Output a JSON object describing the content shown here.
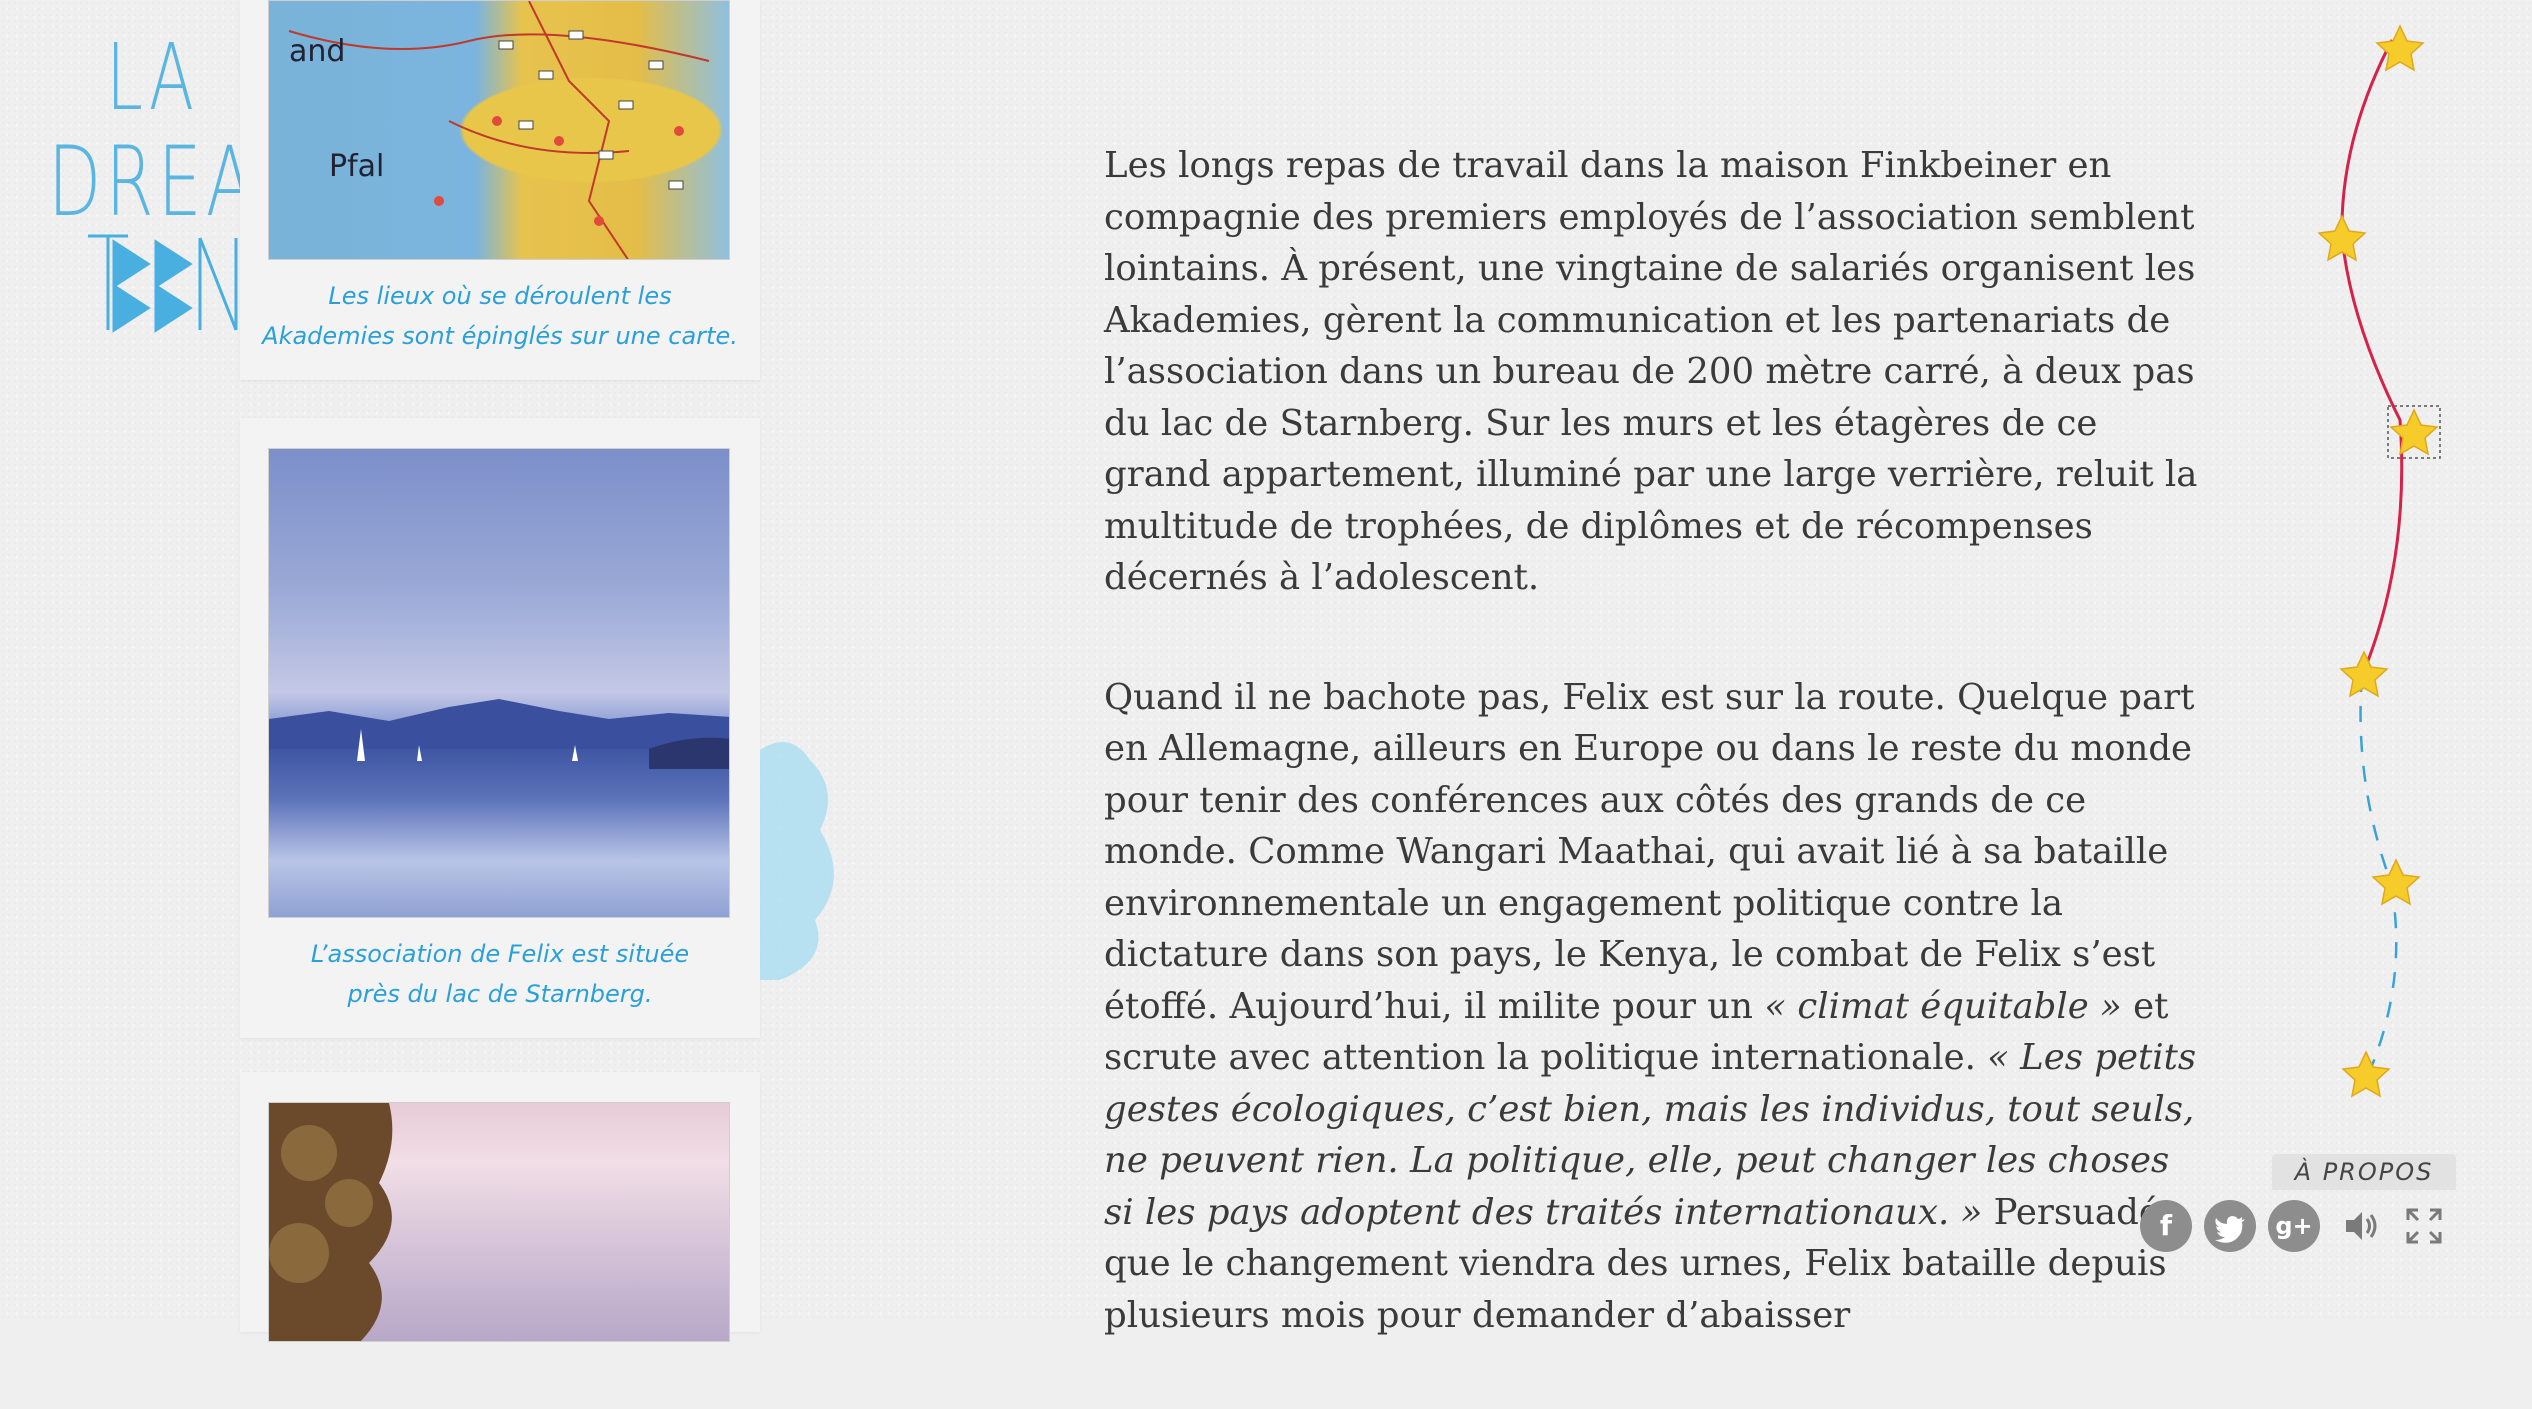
{
  "logo": {
    "line1": "LA",
    "line2": "DREAM",
    "line3": "TEEN"
  },
  "photos": [
    {
      "caption_line1": "Les lieux où se déroulent les",
      "caption_line2": "Akademies sont épinglés sur une carte."
    },
    {
      "caption_line1": "L’association de Felix est située",
      "caption_line2": "près du lac de Starnberg."
    },
    {
      "caption_line1": "",
      "caption_line2": ""
    }
  ],
  "article": {
    "p1": "Les longs repas de travail dans la maison Finkbeiner en compagnie des premiers employés de l’association semblent lointains. À présent, une vingtaine de salariés organisent les Akademies, gèrent la communication et les partenariats de l’association dans un bureau de 200 mètre carré, à deux pas du lac de Starnberg. Sur les murs et les étagères de ce grand appartement, illuminé par une large verrière, reluit la multitude de trophées, de diplômes et de récompenses décernés à l’adolescent.",
    "p2_a": "Quand il ne bachote pas, Felix est sur la route. Quelque part en Allemagne, ailleurs en Europe ou dans le reste du monde pour tenir des conférences aux côtés des grands de ce monde. Comme Wangari Maathai, qui avait lié à sa bataille environnementale un engagement politique contre la dictature dans son pays, le Kenya, le combat de Felix s’est étoffé. Aujourd’hui, il milite pour un ",
    "p2_em1": "« climat équitable »",
    "p2_b": " et scrute avec attention la politique internationale. ",
    "p2_em2": "« Les petits gestes écologiques, c’est bien, mais les individus, tout seuls, ne peuvent rien. La politique, elle, peut changer les choses si les pays adoptent des traités internationaux. »",
    "p2_c": " Persuadé que le changement viendra des urnes, Felix bataille depuis plusieurs mois pour demander d’abaisser"
  },
  "nav": {
    "about_label": "À PROPOS"
  },
  "toolbar": {
    "facebook_glyph": "f",
    "twitter_glyph": "t",
    "google_glyph": "g+"
  },
  "colors": {
    "accent_blue": "#2aa0d8",
    "star": "#f6cc2a",
    "track_red": "#d4224a",
    "track_blue": "#3aa3d6"
  }
}
